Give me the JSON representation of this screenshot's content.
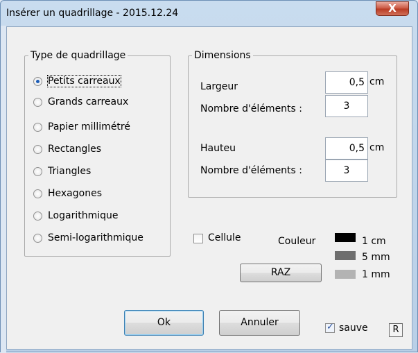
{
  "window": {
    "title": "Insérer un quadrillage - 2015.12.24",
    "close_label": "X"
  },
  "grid_type": {
    "legend": "Type de quadrillage",
    "selected": "Petits carreaux",
    "options": [
      {
        "label": "Petits carreaux",
        "checked": true
      },
      {
        "label": "Grands carreaux",
        "checked": false
      },
      {
        "label": "Papier millimétré",
        "checked": false
      },
      {
        "label": "Rectangles",
        "checked": false
      },
      {
        "label": "Triangles",
        "checked": false
      },
      {
        "label": "Hexagones",
        "checked": false
      },
      {
        "label": "Logarithmique",
        "checked": false
      },
      {
        "label": "Semi-logarithmique",
        "checked": false
      }
    ]
  },
  "dimensions": {
    "legend": "Dimensions",
    "width_label": "Largeur",
    "width_value": "0,5",
    "width_unit": "cm",
    "width_count_label": "Nombre d'éléments :",
    "width_count_value": "3",
    "height_label": "Hauteu",
    "height_value": "0,5",
    "height_unit": "cm",
    "height_count_label": "Nombre d'éléments :",
    "height_count_value": "3"
  },
  "cell": {
    "label": "Cellule",
    "checked": false
  },
  "color": {
    "label": "Couleur",
    "items": [
      {
        "label": "1 cm",
        "color": "#000000"
      },
      {
        "label": "5 mm",
        "color": "#6e6e6e"
      },
      {
        "label": "1 mm",
        "color": "#b3b3b3"
      }
    ]
  },
  "buttons": {
    "raz": "RAZ",
    "ok": "Ok",
    "cancel": "Annuler"
  },
  "save": {
    "label": "sauve",
    "checked": true
  },
  "r_box": "R"
}
